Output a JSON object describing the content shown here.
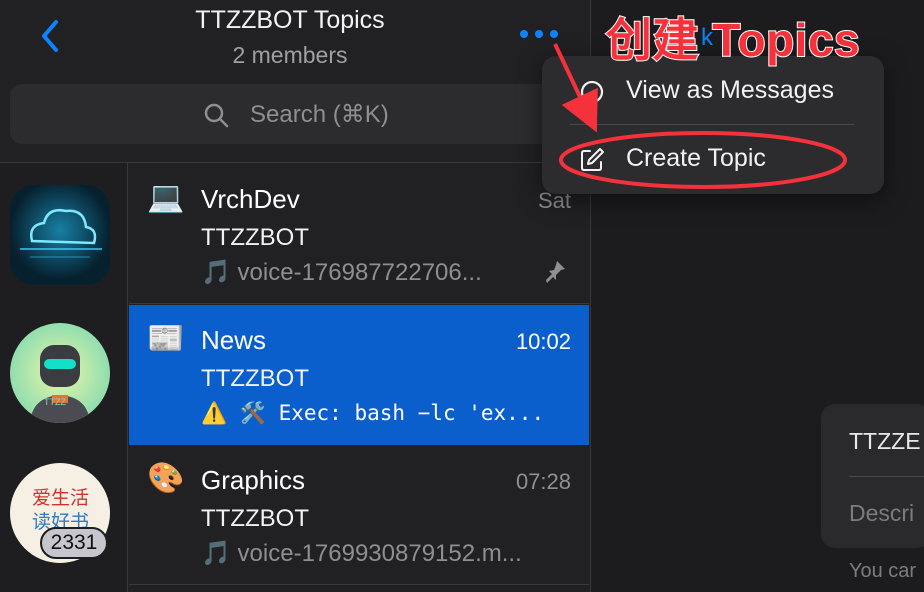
{
  "header": {
    "title": "TTZZBOT Topics",
    "subtitle": "2 members"
  },
  "search": {
    "placeholder": "Search (⌘K)"
  },
  "rail": {
    "badge": "2331",
    "avatar_3_text": [
      "爱生活",
      "读好书"
    ],
    "avatar_2_text": "TTZZ"
  },
  "topics": [
    {
      "icon": "💻",
      "name": "VrchDev",
      "time": "Sat",
      "sender": "TTZZBOT",
      "preview": "🎵 voice-176987722706...",
      "pinned": true
    },
    {
      "icon": "📰",
      "name": "News",
      "time": "10:02",
      "sender": "TTZZBOT",
      "preview": "⚠️ 🛠️ Exec: bash −lc 'ex...",
      "selected": true
    },
    {
      "icon": "🎨",
      "name": "Graphics",
      "time": "07:28",
      "sender": "TTZZBOT",
      "preview": "🎵 voice-1769930879152.m..."
    }
  ],
  "menu": {
    "items": [
      {
        "label": "View as Messages",
        "icon": "circle-icon"
      },
      {
        "label": "Create Topic",
        "icon": "compose-icon"
      }
    ]
  },
  "right_pane": {
    "header_partial": "k",
    "card_title": "TTZZE",
    "card_desc": "Descri",
    "footer": "You car"
  },
  "annotation": {
    "label": "创建 Topics",
    "color": "#f5323c"
  },
  "colors": {
    "accent": "#0a84ff",
    "selected_row": "#0a5fcc",
    "annotation_red": "#f5323c"
  }
}
